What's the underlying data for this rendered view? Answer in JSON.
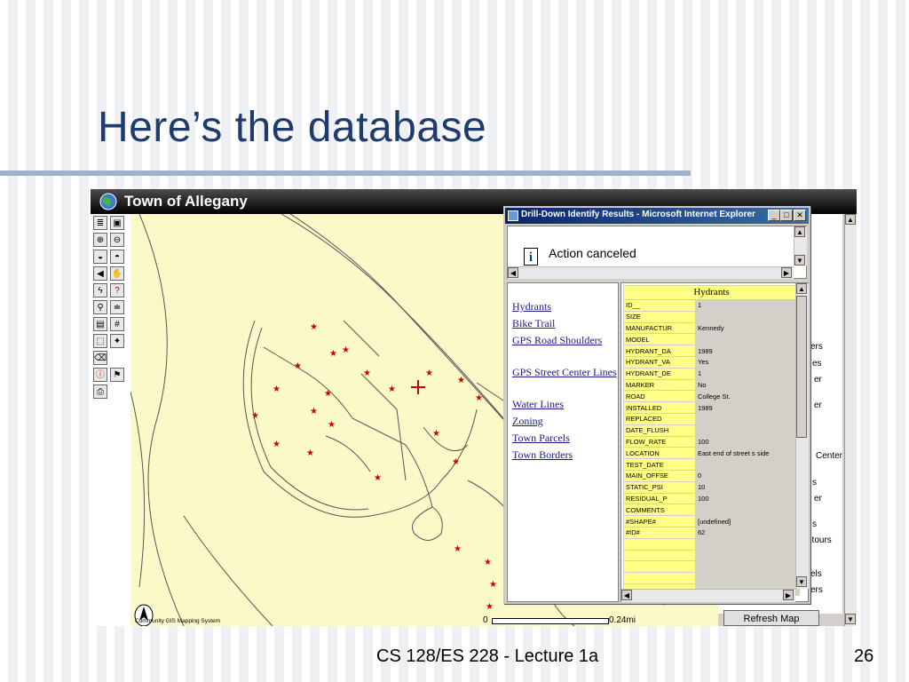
{
  "slide": {
    "title": "Here’s the database",
    "footer": "CS 128/ES 228 - Lecture 1a",
    "page_number": "26"
  },
  "app": {
    "title": "Town of Allegany",
    "logo_text": "Community GIS Mapping System",
    "north_label": "N",
    "scale": {
      "start": "0",
      "end": "0.24mi"
    },
    "refresh_button": "Refresh Map",
    "right_panel_items": [
      "ers",
      "es",
      "er",
      "er",
      "Center",
      "s",
      "er",
      "s",
      "ntours",
      "els",
      "ers"
    ]
  },
  "popup": {
    "title": "Drill-Down Identify Results - Microsoft Internet Explorer",
    "message": "Action canceled",
    "layers": [
      "Hydrants",
      "Bike Trail",
      "GPS Road Shoulders",
      "GPS Street Center Lines",
      "Water Lines",
      "Zoning",
      "Town Parcels",
      "Town Borders"
    ],
    "table_title": "Hydrants",
    "rows": [
      {
        "field": "ID__",
        "value": "1"
      },
      {
        "field": "SIZE",
        "value": ""
      },
      {
        "field": "MANUFACTUR",
        "value": "Kennedy"
      },
      {
        "field": "MODEL",
        "value": ""
      },
      {
        "field": "HYDRANT_DA",
        "value": "1989"
      },
      {
        "field": "HYDRANT_VA",
        "value": "Yes"
      },
      {
        "field": "HYDRANT_DE",
        "value": "1"
      },
      {
        "field": "MARKER",
        "value": "No"
      },
      {
        "field": "ROAD",
        "value": "College St."
      },
      {
        "field": "INSTALLED",
        "value": "1989"
      },
      {
        "field": "REPLACED",
        "value": ""
      },
      {
        "field": "DATE_FLUSH",
        "value": ""
      },
      {
        "field": "FLOW_RATE",
        "value": "100"
      },
      {
        "field": "LOCATION",
        "value": "East end of street s side"
      },
      {
        "field": "TEST_DATE",
        "value": ""
      },
      {
        "field": "MAIN_OFFSE",
        "value": "0"
      },
      {
        "field": "STATIC_PSI",
        "value": "10"
      },
      {
        "field": "RESIDUAL_P",
        "value": "100"
      },
      {
        "field": "COMMENTS",
        "value": ""
      },
      {
        "field": "#SHAPE#",
        "value": "[undefined]"
      },
      {
        "field": "#ID#",
        "value": "62"
      },
      {
        "field": "",
        "value": ""
      },
      {
        "field": "",
        "value": ""
      },
      {
        "field": "",
        "value": ""
      },
      {
        "field": "",
        "value": ""
      },
      {
        "field": "",
        "value": ""
      }
    ]
  },
  "colors": {
    "title_color": "#1f3b6b",
    "map_background": "#fcf9c8",
    "hydrant_marker": "#d00000",
    "field_cell": "#ffff88",
    "link_color": "#1a1a8c"
  }
}
